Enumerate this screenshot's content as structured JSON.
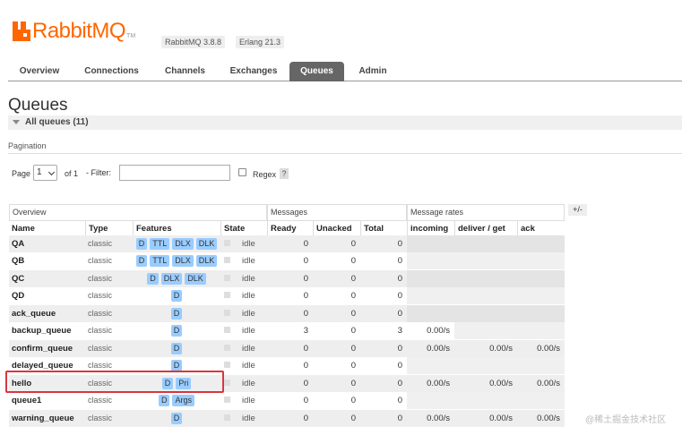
{
  "header": {
    "logo_text": "RabbitMQ",
    "logo_tm": "TM",
    "version": "RabbitMQ 3.8.8",
    "erlang": "Erlang 21.3"
  },
  "tabs": [
    {
      "label": "Overview",
      "active": false
    },
    {
      "label": "Connections",
      "active": false
    },
    {
      "label": "Channels",
      "active": false
    },
    {
      "label": "Exchanges",
      "active": false
    },
    {
      "label": "Queues",
      "active": true
    },
    {
      "label": "Admin",
      "active": false
    }
  ],
  "page": {
    "title": "Queues",
    "section_label": "All queues (11)"
  },
  "pagination": {
    "label": "Pagination",
    "page_label": "Page",
    "page_value": "1",
    "of_label": "of 1",
    "filter_label": "- Filter:",
    "filter_value": "",
    "regex_label": "Regex",
    "help_label": "?"
  },
  "table": {
    "groups": [
      "Overview",
      "Messages",
      "Message rates"
    ],
    "plus_minus": "+/-",
    "headers": [
      "Name",
      "Type",
      "Features",
      "State",
      "Ready",
      "Unacked",
      "Total",
      "incoming",
      "deliver / get",
      "ack"
    ],
    "rows": [
      {
        "name": "QA",
        "type": "classic",
        "features": [
          "D",
          "TTL",
          "DLX",
          "DLK"
        ],
        "state": "idle",
        "ready": "0",
        "unacked": "0",
        "total": "0",
        "incoming": "",
        "deliver": "",
        "ack": ""
      },
      {
        "name": "QB",
        "type": "classic",
        "features": [
          "D",
          "TTL",
          "DLX",
          "DLK"
        ],
        "state": "idle",
        "ready": "0",
        "unacked": "0",
        "total": "0",
        "incoming": "",
        "deliver": "",
        "ack": ""
      },
      {
        "name": "QC",
        "type": "classic",
        "features": [
          "D",
          "DLX",
          "DLK"
        ],
        "state": "idle",
        "ready": "0",
        "unacked": "0",
        "total": "0",
        "incoming": "",
        "deliver": "",
        "ack": ""
      },
      {
        "name": "QD",
        "type": "classic",
        "features": [
          "D"
        ],
        "state": "idle",
        "ready": "0",
        "unacked": "0",
        "total": "0",
        "incoming": "",
        "deliver": "",
        "ack": ""
      },
      {
        "name": "ack_queue",
        "type": "classic",
        "features": [
          "D"
        ],
        "state": "idle",
        "ready": "0",
        "unacked": "0",
        "total": "0",
        "incoming": "",
        "deliver": "",
        "ack": ""
      },
      {
        "name": "backup_queue",
        "type": "classic",
        "features": [
          "D"
        ],
        "state": "idle",
        "ready": "3",
        "unacked": "0",
        "total": "3",
        "incoming": "0.00/s",
        "deliver": "",
        "ack": ""
      },
      {
        "name": "confirm_queue",
        "type": "classic",
        "features": [
          "D"
        ],
        "state": "idle",
        "ready": "0",
        "unacked": "0",
        "total": "0",
        "incoming": "0.00/s",
        "deliver": "0.00/s",
        "ack": "0.00/s"
      },
      {
        "name": "delayed_queue",
        "type": "classic",
        "features": [
          "D"
        ],
        "state": "idle",
        "ready": "0",
        "unacked": "0",
        "total": "0",
        "incoming": "",
        "deliver": "",
        "ack": ""
      },
      {
        "name": "hello",
        "type": "classic",
        "features": [
          "D",
          "Pri"
        ],
        "state": "idle",
        "ready": "0",
        "unacked": "0",
        "total": "0",
        "incoming": "0.00/s",
        "deliver": "0.00/s",
        "ack": "0.00/s"
      },
      {
        "name": "queue1",
        "type": "classic",
        "features": [
          "D",
          "Args"
        ],
        "state": "idle",
        "ready": "0",
        "unacked": "0",
        "total": "0",
        "incoming": "",
        "deliver": "",
        "ack": ""
      },
      {
        "name": "warning_queue",
        "type": "classic",
        "features": [
          "D"
        ],
        "state": "idle",
        "ready": "0",
        "unacked": "0",
        "total": "0",
        "incoming": "0.00/s",
        "deliver": "0.00/s",
        "ack": "0.00/s"
      }
    ]
  },
  "watermark": "@稀土掘金技术社区"
}
